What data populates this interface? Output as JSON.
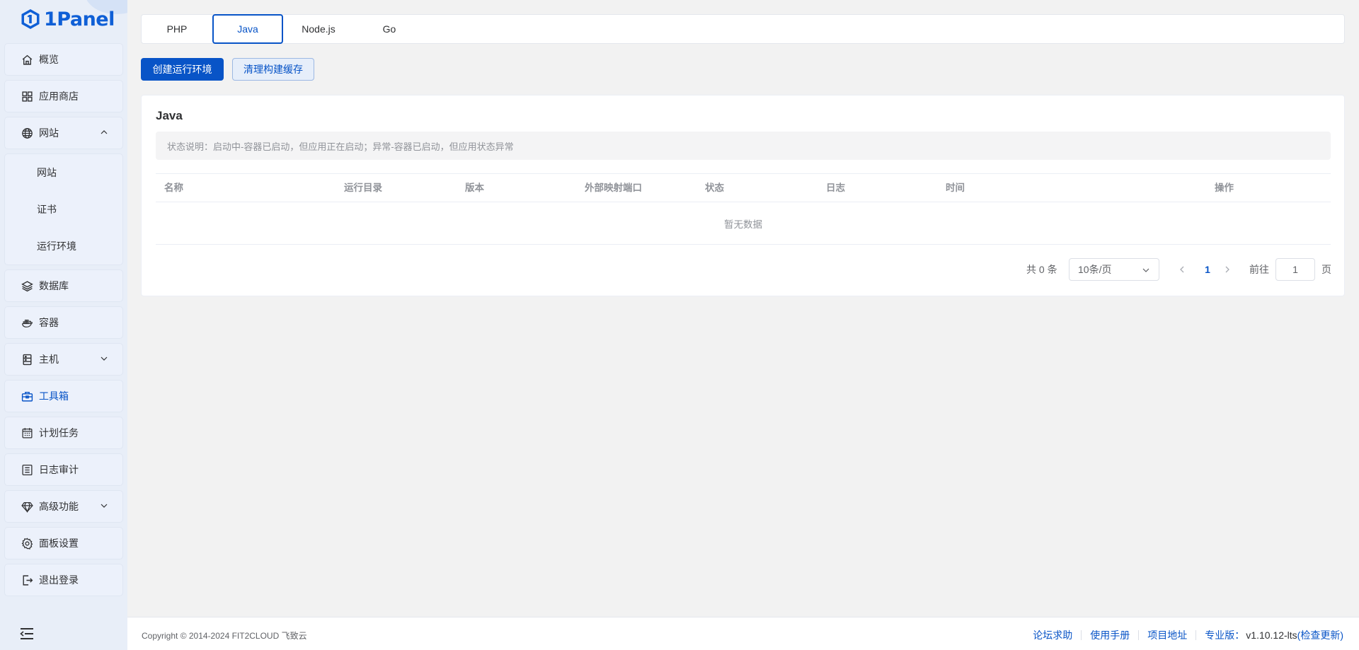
{
  "app": {
    "logo_text": "1Panel"
  },
  "sidebar": {
    "items": [
      {
        "label": "概览",
        "icon": "home-icon"
      },
      {
        "label": "应用商店",
        "icon": "grid-icon"
      },
      {
        "label": "网站",
        "icon": "globe-icon",
        "expanded": true
      },
      {
        "label": "数据库",
        "icon": "layers-icon"
      },
      {
        "label": "容器",
        "icon": "docker-icon"
      },
      {
        "label": "主机",
        "icon": "server-icon"
      },
      {
        "label": "工具箱",
        "icon": "toolbox-icon",
        "active": true
      },
      {
        "label": "计划任务",
        "icon": "calendar-icon"
      },
      {
        "label": "日志审计",
        "icon": "log-icon"
      },
      {
        "label": "高级功能",
        "icon": "diamond-icon"
      },
      {
        "label": "面板设置",
        "icon": "gear-icon"
      },
      {
        "label": "退出登录",
        "icon": "logout-icon"
      }
    ],
    "website_sub": [
      "网站",
      "证书",
      "运行环境"
    ]
  },
  "tabs": [
    "PHP",
    "Java",
    "Node.js",
    "Go"
  ],
  "active_tab": "Java",
  "toolbar": {
    "create_label": "创建运行环境",
    "clean_label": "清理构建缓存"
  },
  "card": {
    "title": "Java",
    "alert": "状态说明：启动中-容器已启动，但应用正在启动；异常-容器已启动，但应用状态异常"
  },
  "table": {
    "columns": [
      "名称",
      "运行目录",
      "版本",
      "外部映射端口",
      "状态",
      "日志",
      "时间",
      "操作"
    ],
    "empty_text": "暂无数据"
  },
  "pagination": {
    "total": "共 0 条",
    "page_size": "10条/页",
    "current_page": "1",
    "goto_label": "前往",
    "goto_value": "1",
    "page_unit": "页"
  },
  "footer": {
    "copyright": "Copyright © 2014-2024 FIT2CLOUD 飞致云",
    "links": [
      "论坛求助",
      "使用手册",
      "项目地址"
    ],
    "edition_label": "专业版：",
    "version": "v1.10.12-lts",
    "check_update": "(检查更新)"
  },
  "colors": {
    "primary": "#0854c7",
    "sidebar_bg": "#e8eef8",
    "page_bg": "#f2f2f2"
  }
}
